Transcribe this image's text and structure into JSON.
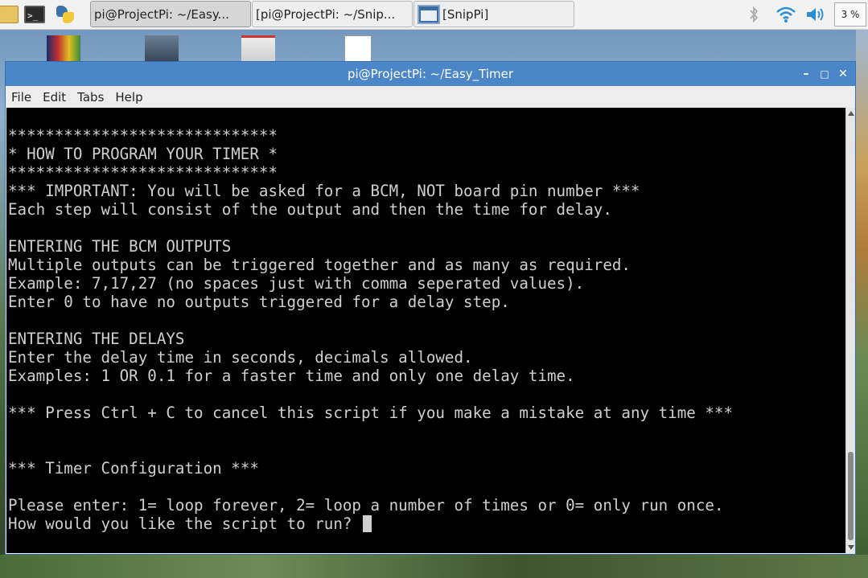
{
  "panel": {
    "launchers": [
      "folder-icon",
      "terminal-icon",
      "python-icon"
    ],
    "terminal_glyph": ">_",
    "tasks": [
      {
        "label": "pi@ProjectPi: ~/Easy...",
        "icon": "terminal-icon",
        "active": true
      },
      {
        "label": "[pi@ProjectPi: ~/Snip...",
        "icon": "terminal-icon",
        "active": false
      },
      {
        "label": "[SnipPi]",
        "icon": "snippi-icon",
        "active": false
      }
    ],
    "cpu_label": "3 %"
  },
  "window": {
    "title": "pi@ProjectPi: ~/Easy_Timer",
    "menu": [
      "File",
      "Edit",
      "Tabs",
      "Help"
    ],
    "title_color": "#4a86c8"
  },
  "terminal": {
    "lines": [
      "*****************************",
      "* HOW TO PROGRAM YOUR TIMER *",
      "*****************************",
      "*** IMPORTANT: You will be asked for a BCM, NOT board pin number ***",
      "Each step will consist of the output and then the time for delay.",
      "",
      "ENTERING THE BCM OUTPUTS",
      "Multiple outputs can be triggered together and as many as required.",
      "Example: 7,17,27 (no spaces just with comma seperated values).",
      "Enter 0 to have no outputs triggered for a delay step.",
      "",
      "ENTERING THE DELAYS",
      "Enter the delay time in seconds, decimals allowed.",
      "Examples: 1 OR 0.1 for a faster time and only one delay time.",
      "",
      "*** Press Ctrl + C to cancel this script if you make a mistake at any time ***",
      "",
      "",
      "*** Timer Configuration ***",
      "",
      "Please enter: 1= loop forever, 2= loop a number of times or 0= only run once.",
      "How would you like the script to run? "
    ]
  }
}
